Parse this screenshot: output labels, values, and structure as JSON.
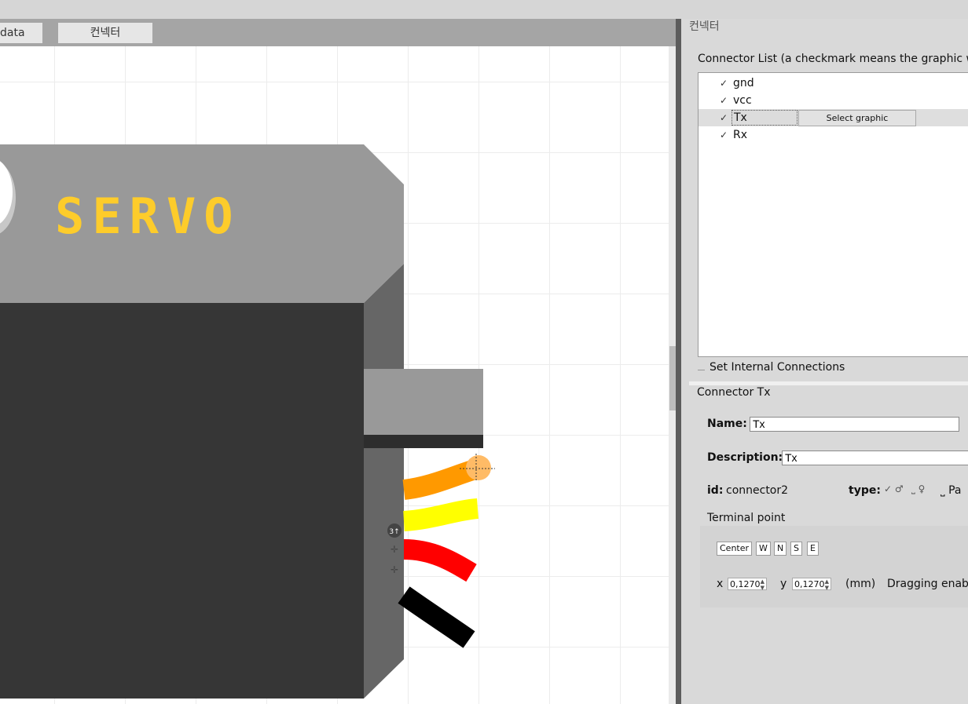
{
  "tabs": {
    "data_tab": "data",
    "connectors_tab": "컨넥터"
  },
  "panel": {
    "title": "컨넥터",
    "list_caption": "Connector List (a checkmark means the graphic was",
    "connectors": [
      {
        "name": "gnd",
        "checked": "✓"
      },
      {
        "name": "vcc",
        "checked": "✓"
      },
      {
        "name": "Tx",
        "checked": "✓"
      },
      {
        "name": "Rx",
        "checked": "✓"
      }
    ],
    "select_graphic_button": "Select graphic",
    "internal_connections": "Set Internal Connections",
    "connector_title": "Connector Tx"
  },
  "form": {
    "name_label": "Name:",
    "name_value": "Tx",
    "description_label": "Description:",
    "description_value": "Tx",
    "id_label": "id:",
    "id_value": "connector2",
    "type_label": "type:",
    "type_male": "♂",
    "type_female": "♀",
    "type_pad": "Pa"
  },
  "terminal": {
    "title": "Terminal point",
    "buttons": [
      "Center",
      "W",
      "N",
      "S",
      "E"
    ],
    "x_label": "x",
    "x_value": "0,1270",
    "y_label": "y",
    "y_value": "0,1270",
    "units": "(mm)",
    "dragging": "Dragging enable"
  },
  "canvas": {
    "servo_text": "SERVO",
    "badge": "3↑",
    "colors": {
      "accent_text": "#fdcc2b",
      "body_dark": "#363636",
      "body_side": "#666666",
      "top_face": "#999999",
      "wire_orange": "#ff9900",
      "wire_yellow": "#ffff00",
      "wire_red": "#ff0000",
      "wire_black": "#000000"
    }
  }
}
